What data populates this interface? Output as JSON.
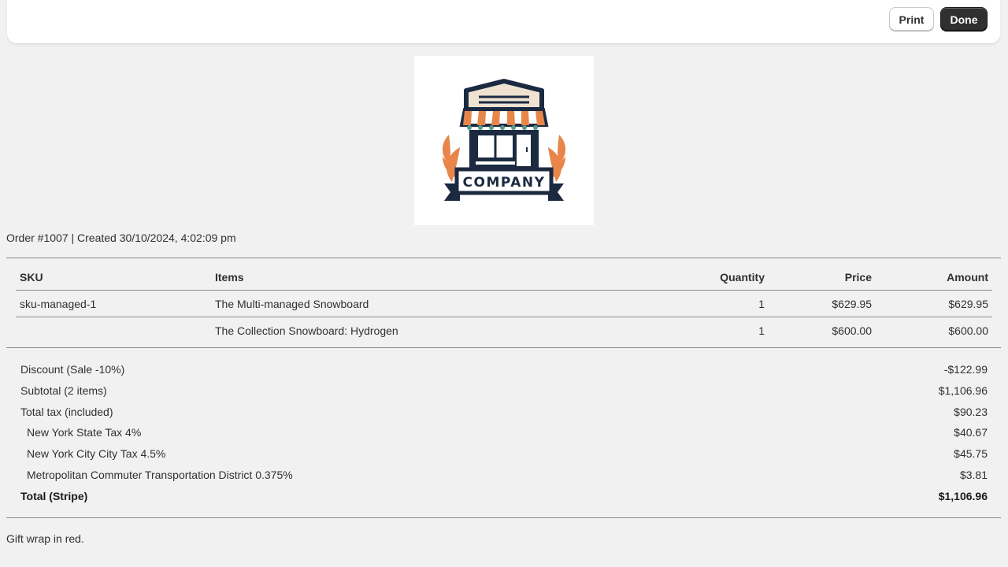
{
  "toolbar": {
    "print_label": "Print",
    "done_label": "Done"
  },
  "logo": {
    "text": "COMPANY",
    "colors": {
      "navy": "#1b2a41",
      "orange": "#e8864a",
      "cream": "#efe2d0",
      "teal": "#5a9a8b"
    }
  },
  "order": {
    "summary": "Order #1007 | Created 30/10/2024, 4:02:09 pm"
  },
  "table": {
    "headers": {
      "sku": "SKU",
      "items": "Items",
      "quantity": "Quantity",
      "price": "Price",
      "amount": "Amount"
    },
    "rows": [
      {
        "sku": "sku-managed-1",
        "item": "The Multi-managed Snowboard",
        "quantity": "1",
        "price": "$629.95",
        "amount": "$629.95"
      },
      {
        "sku": "",
        "item": "The Collection Snowboard: Hydrogen",
        "quantity": "1",
        "price": "$600.00",
        "amount": "$600.00"
      }
    ]
  },
  "totals": {
    "discount": {
      "label": "Discount (Sale -10%)",
      "value": "-$122.99"
    },
    "subtotal": {
      "label": "Subtotal (2 items)",
      "value": "$1,106.96"
    },
    "total_tax": {
      "label": "Total tax (included)",
      "value": "$90.23"
    },
    "taxes": [
      {
        "label": "New York State Tax 4%",
        "value": "$40.67"
      },
      {
        "label": "New York City City Tax 4.5%",
        "value": "$45.75"
      },
      {
        "label": "Metropolitan Commuter Transportation District 0.375%",
        "value": "$3.81"
      }
    ],
    "total": {
      "label": "Total (Stripe)",
      "value": "$1,106.96"
    }
  },
  "note": "Gift wrap in red."
}
